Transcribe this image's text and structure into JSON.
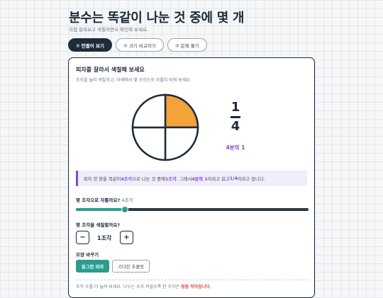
{
  "header": {
    "title": "분수는 똑같이 나눈 것 중에 몇 개",
    "subtitle": "직접 잘라보고 색칠하면서 확인해 보세요."
  },
  "tabs": [
    {
      "label": "① 만들어 보기",
      "active": true
    },
    {
      "label": "② 크기 비교하기",
      "active": false
    },
    {
      "label": "③ 문제 풀기",
      "active": false
    }
  ],
  "card": {
    "title": "피자를 잘라서 색칠해 보세요",
    "description": "조각을 눌러 색칠하고, 아래에서 몇 조각으로 자를지 바꿔 보세요."
  },
  "pie": {
    "slices": 4,
    "shaded": 1,
    "shade_color": "#f2a33a"
  },
  "fraction": {
    "numerator": "1",
    "denominator": "4",
    "reading": "4분의 1"
  },
  "callout": {
    "p1": "피자 한 판을 똑같이 ",
    "b1": "4조각",
    "p2": "으로 나눈 것 중에 ",
    "b2": "1조각",
    "p3": ". 그래서 ",
    "b3": "4분의 1",
    "p4": "이라고 읽고 ",
    "b4": "1/4",
    "p5": "이라고 씁니다."
  },
  "controls": {
    "cut_label": "몇 조각으로 자를까요?",
    "cut_value": "4조각",
    "slider_fraction": 0.21,
    "color_label": "몇 조각을 색칠할까요?",
    "stepper_minus": "−",
    "stepper_value": "1조각",
    "stepper_plus": "+",
    "shape_label": "모양 바꾸기",
    "shapes": [
      {
        "label": "동그란 피자",
        "active": true
      },
      {
        "label": "기다란 초콜릿",
        "active": false
      }
    ]
  },
  "footer": {
    "hint_prefix": "조각 수를 더 늘려 보세요. 나누는 수가 커질수록 한 조각은 ",
    "hint_emphasis": "점점 작아집니다",
    "hint_suffix": "."
  },
  "colors": {
    "accent_teal": "#2a9d8f",
    "accent_purple": "#7b4fd0",
    "navy": "#1d2b3c"
  }
}
